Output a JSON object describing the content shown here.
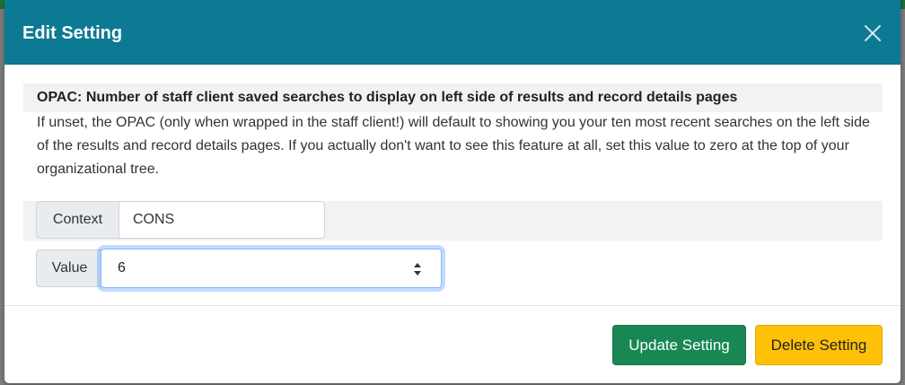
{
  "modal": {
    "title": "Edit Setting",
    "close_icon": "close-icon"
  },
  "setting": {
    "name": "OPAC: Number of staff client saved searches to display on left side of results and record details pages",
    "description": "If unset, the OPAC (only when wrapped in the staff client!) will default to showing you your ten most recent searches on the left side of the results and record details pages. If you actually don't want to see this feature at all, set this value to zero at the top of your organizational tree."
  },
  "context": {
    "label": "Context",
    "value": "CONS"
  },
  "value_field": {
    "label": "Value",
    "value": "6",
    "spinner_icon": "number-spinner-icon"
  },
  "footer": {
    "update_label": "Update Setting",
    "delete_label": "Delete Setting"
  },
  "colors": {
    "header": "#0d7a93",
    "update_button": "#198754",
    "delete_button": "#ffc107",
    "focus_ring": "#86b7fe"
  }
}
